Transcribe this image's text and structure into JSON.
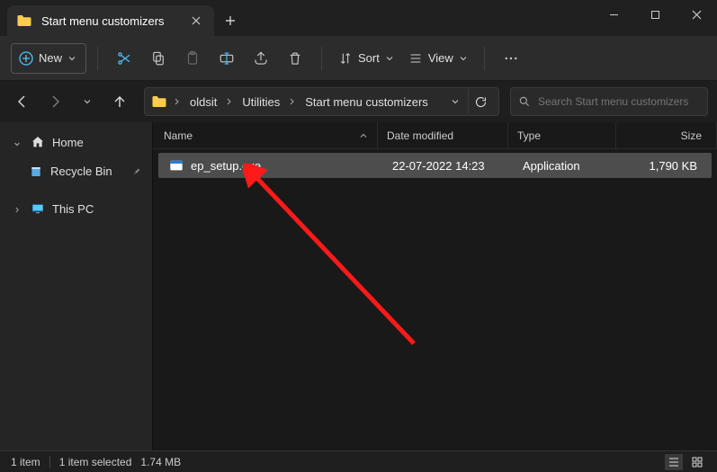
{
  "window": {
    "tab_title": "Start menu customizers",
    "search_placeholder": "Search Start menu customizers"
  },
  "toolbar": {
    "new_label": "New",
    "sort_label": "Sort",
    "view_label": "View"
  },
  "breadcrumb": {
    "segments": [
      "oldsit",
      "Utilities",
      "Start menu customizers"
    ]
  },
  "sidebar": {
    "home": "Home",
    "recycle": "Recycle Bin",
    "thispc": "This PC"
  },
  "columns": {
    "name": "Name",
    "date": "Date modified",
    "type": "Type",
    "size": "Size"
  },
  "files": [
    {
      "name": "ep_setup.exe",
      "date": "22-07-2022 14:23",
      "type": "Application",
      "size": "1,790 KB"
    }
  ],
  "status": {
    "count": "1 item",
    "selected": "1 item selected",
    "size": "1.74 MB"
  }
}
